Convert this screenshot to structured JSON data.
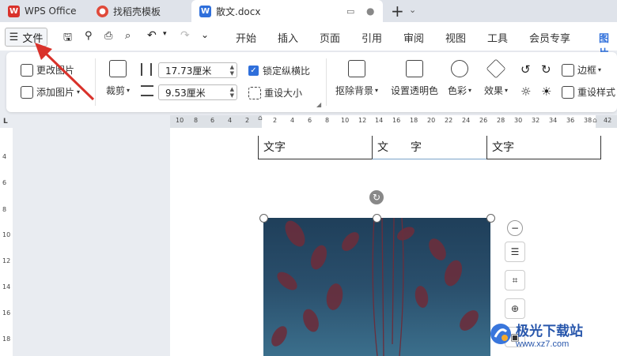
{
  "tabs": [
    {
      "label": "WPS Office"
    },
    {
      "label": "找稻壳模板"
    },
    {
      "label": "散文.docx"
    }
  ],
  "menu": {
    "file_label": "文件",
    "items": [
      "开始",
      "插入",
      "页面",
      "引用",
      "审阅",
      "视图",
      "工具",
      "会员专享",
      "图片"
    ]
  },
  "ribbon": {
    "change_image": "更改图片",
    "add_image": "添加图片",
    "crop": "裁剪",
    "width_value": "17.73厘米",
    "height_value": "9.53厘米",
    "lock_ratio": "锁定纵横比",
    "reset_size": "重设大小",
    "remove_bg": "抠除背景",
    "set_transparent": "设置透明色",
    "color": "色彩",
    "effect": "效果",
    "border": "边框",
    "reset_style": "重设样式"
  },
  "ruler": {
    "h_left_ticks": [
      "10",
      "8",
      "6",
      "4",
      "2"
    ],
    "h_right_ticks": [
      "2",
      "4",
      "6",
      "8",
      "10",
      "12",
      "14",
      "16",
      "18",
      "20",
      "22",
      "24",
      "26",
      "28",
      "30",
      "32",
      "34",
      "36",
      "38",
      "42"
    ],
    "v_ticks": [
      "4",
      "6",
      "8",
      "10",
      "12",
      "14",
      "16",
      "18"
    ]
  },
  "table": {
    "cells": [
      "文字",
      "文　　字",
      "文字"
    ]
  },
  "watermark": {
    "title": "极光下载站",
    "url": "www.xz7.com"
  },
  "colors": {
    "accent": "#d9322b",
    "selected_tab": "#2f6fdb",
    "annotation_arrow": "#d9322b"
  }
}
